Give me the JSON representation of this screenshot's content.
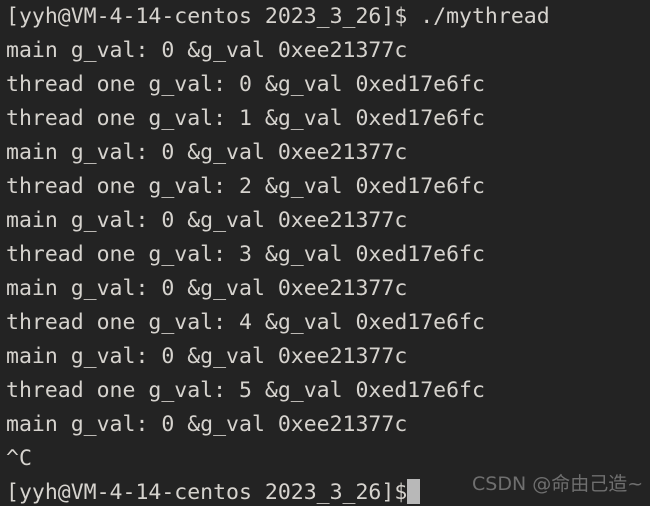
{
  "terminal": {
    "background_color": "#232323",
    "text_color": "#d6d3ce",
    "cursor_color": "#b8b8b8",
    "prompt": "[yyh@VM-4-14-centos 2023_3_26]$",
    "command": "./mythread",
    "lines": [
      "[yyh@VM-4-14-centos 2023_3_26]$ ./mythread",
      "main g_val: 0 &g_val 0xee21377c",
      "thread one g_val: 0 &g_val 0xed17e6fc",
      "thread one g_val: 1 &g_val 0xed17e6fc",
      "main g_val: 0 &g_val 0xee21377c",
      "thread one g_val: 2 &g_val 0xed17e6fc",
      "main g_val: 0 &g_val 0xee21377c",
      "thread one g_val: 3 &g_val 0xed17e6fc",
      "main g_val: 0 &g_val 0xee21377c",
      "thread one g_val: 4 &g_val 0xed17e6fc",
      "main g_val: 0 &g_val 0xee21377c",
      "thread one g_val: 5 &g_val 0xed17e6fc",
      "main g_val: 0 &g_val 0xee21377c",
      "^C"
    ],
    "last_prompt": "[yyh@VM-4-14-centos 2023_3_26]$",
    "interrupt_signal": "^C",
    "main_address": "0xee21377c",
    "thread_address": "0xed17e6fc"
  },
  "watermark": {
    "text": "CSDN @命由己造~",
    "color": "#6f6f6f"
  }
}
